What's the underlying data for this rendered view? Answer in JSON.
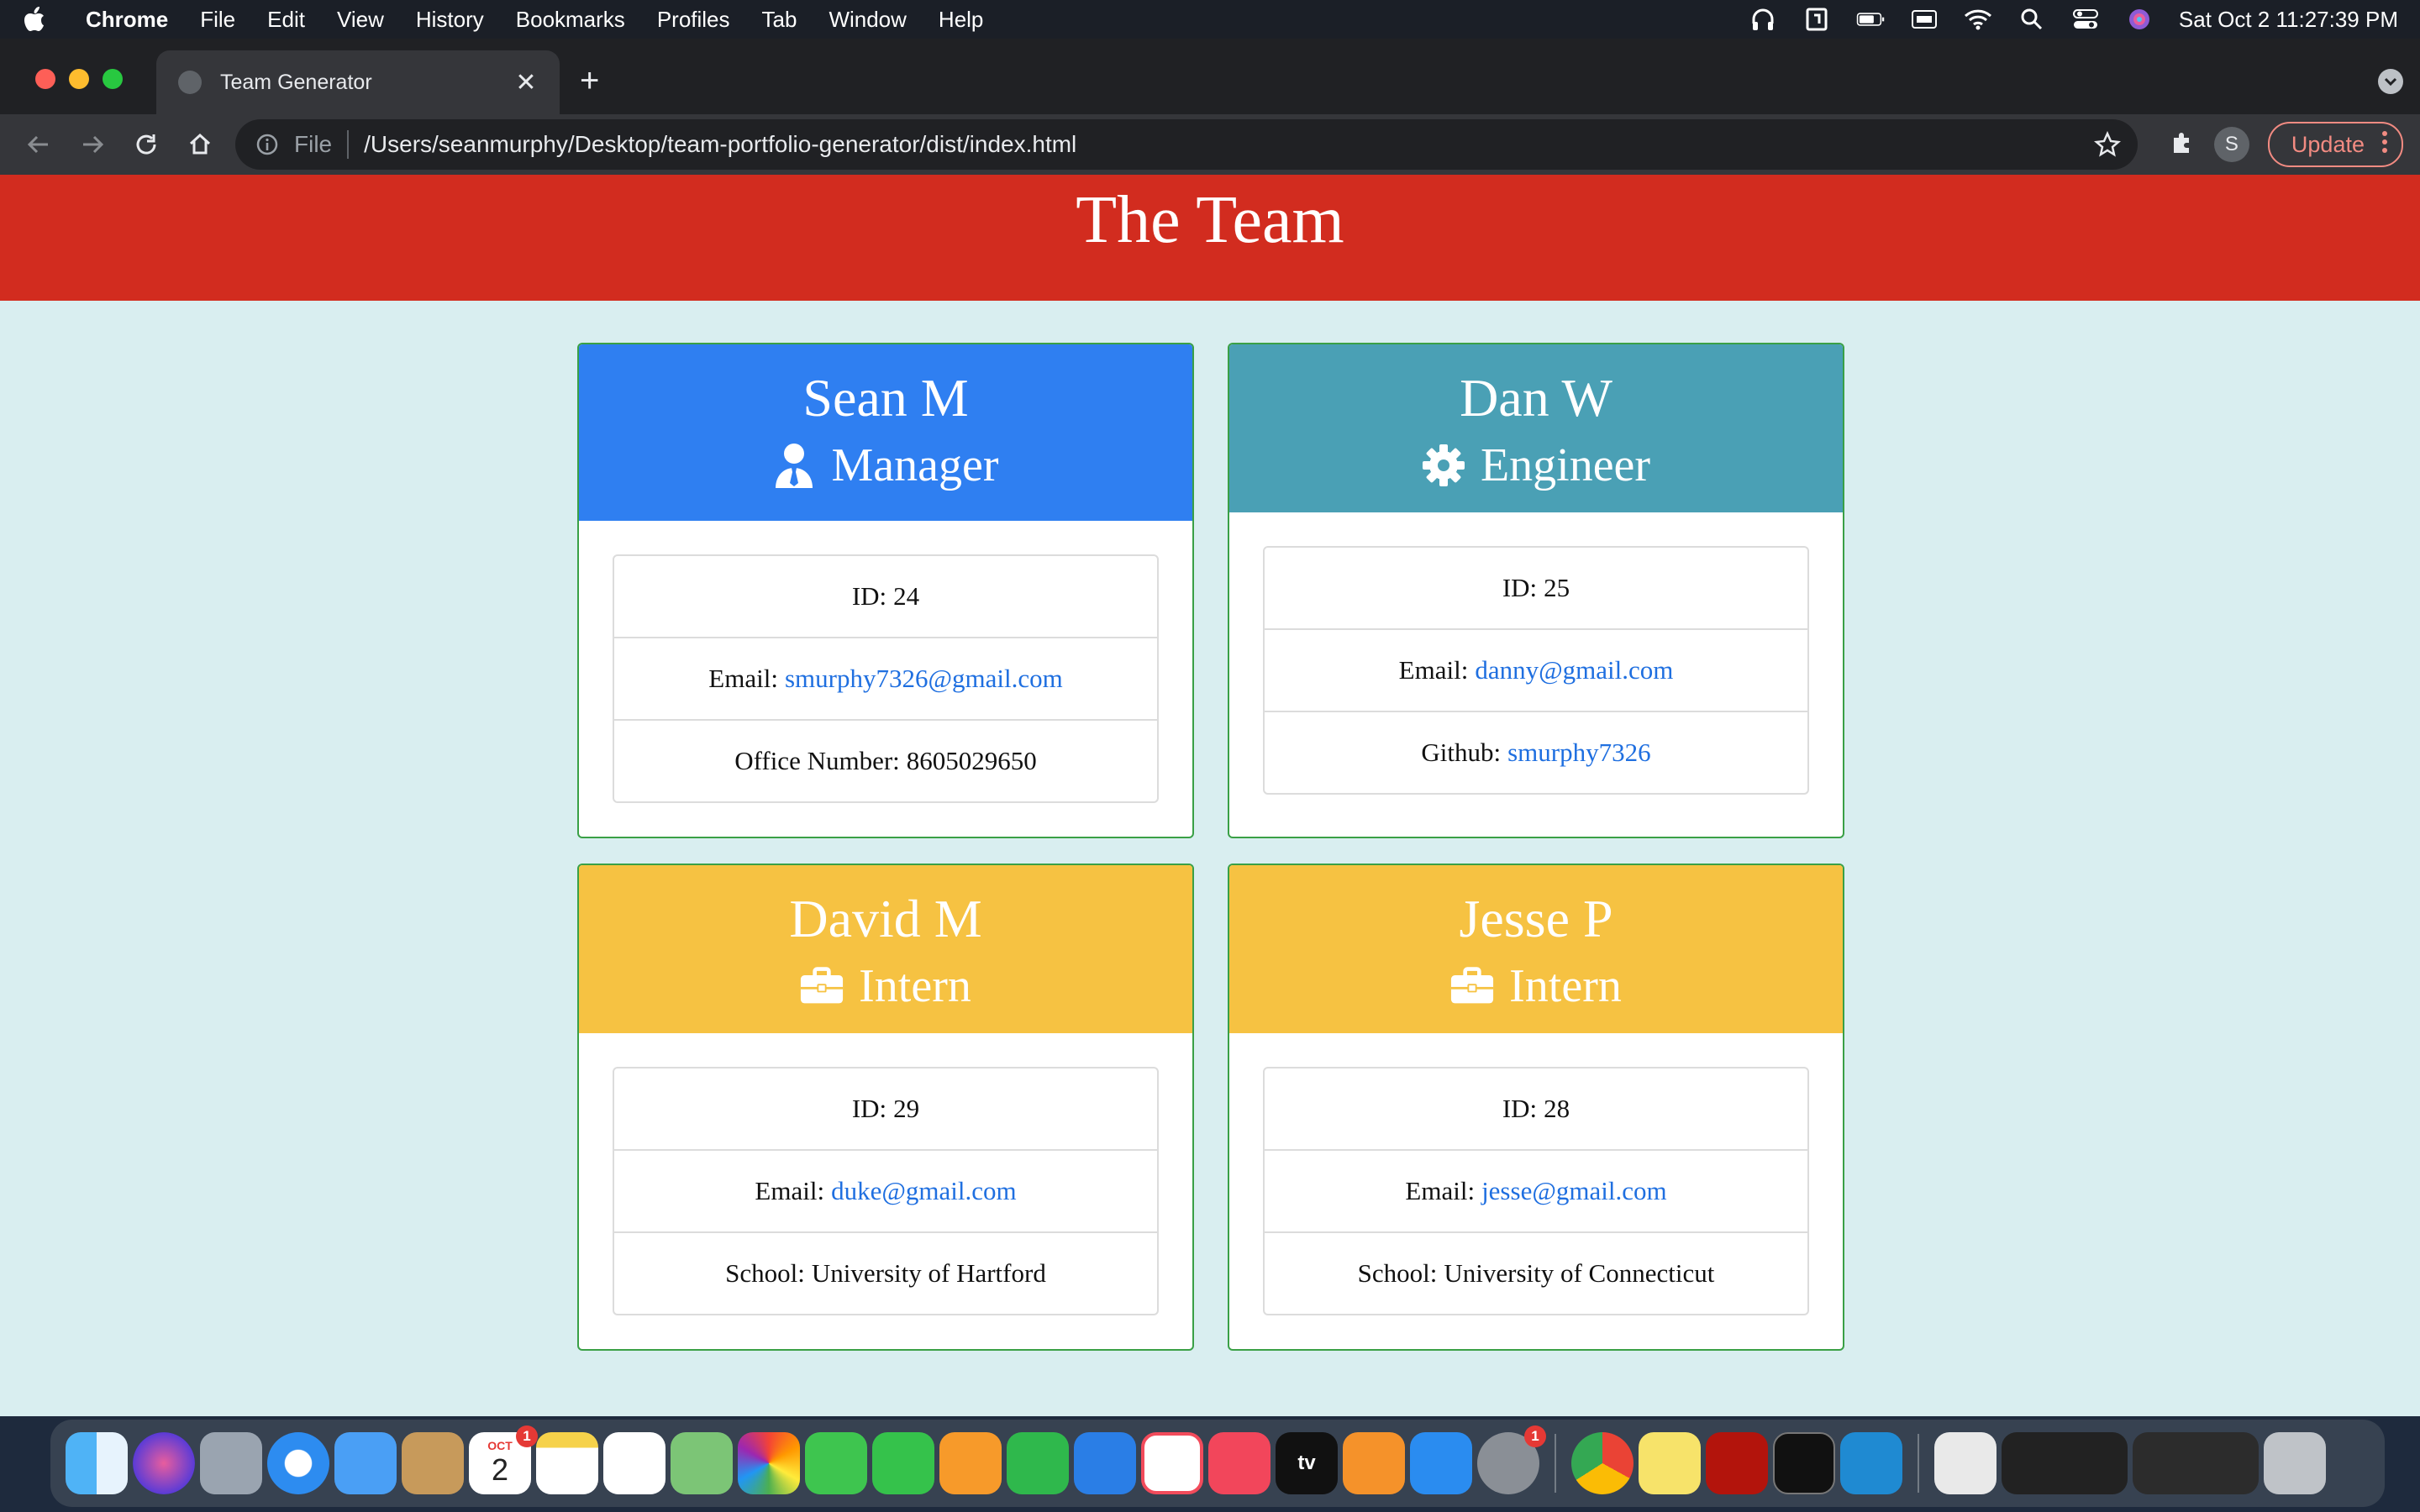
{
  "menubar": {
    "app_name": "Chrome",
    "menus": [
      "File",
      "Edit",
      "View",
      "History",
      "Bookmarks",
      "Profiles",
      "Tab",
      "Window",
      "Help"
    ],
    "clock": "Sat Oct 2  11:27:39 PM"
  },
  "browser": {
    "tab_title": "Team Generator",
    "url_scheme": "File",
    "url": "/Users/seanmurphy/Desktop/team-portfolio-generator/dist/index.html",
    "profile_initial": "S",
    "update_label": "Update"
  },
  "page": {
    "heading": "The Team",
    "members": [
      {
        "name": "Sean M",
        "role": "Manager",
        "role_icon": "user-tie-icon",
        "id_label": "ID:",
        "id": "24",
        "email_label": "Email:",
        "email": "smurphy7326@gmail.com",
        "extra_label": "Office Number:",
        "extra": "8605029650"
      },
      {
        "name": "Dan W",
        "role": "Engineer",
        "role_icon": "gear-icon",
        "id_label": "ID:",
        "id": "25",
        "email_label": "Email:",
        "email": "danny@gmail.com",
        "extra_label": "Github:",
        "extra": "smurphy7326"
      },
      {
        "name": "David M",
        "role": "Intern",
        "role_icon": "briefcase-icon",
        "id_label": "ID:",
        "id": "29",
        "email_label": "Email:",
        "email": "duke@gmail.com",
        "extra_label": "School:",
        "extra": "University of Hartford"
      },
      {
        "name": "Jesse P",
        "role": "Intern",
        "role_icon": "briefcase-icon",
        "id_label": "ID:",
        "id": "28",
        "email_label": "Email:",
        "email": "jesse@gmail.com",
        "extra_label": "School:",
        "extra": "University of Connecticut"
      }
    ]
  },
  "colors": {
    "header_red": "#d22c1f",
    "manager_blue": "#2f7ff1",
    "engineer_teal": "#4aa0b5",
    "intern_yellow": "#f6c242",
    "page_bg": "#d9eef0",
    "card_border": "#3aa046",
    "link": "#1f6fe0"
  },
  "dock": {
    "calendar_month": "OCT",
    "calendar_day": "2",
    "calendar_badge": "1",
    "settings_badge": "1",
    "tv_label": "tv"
  }
}
